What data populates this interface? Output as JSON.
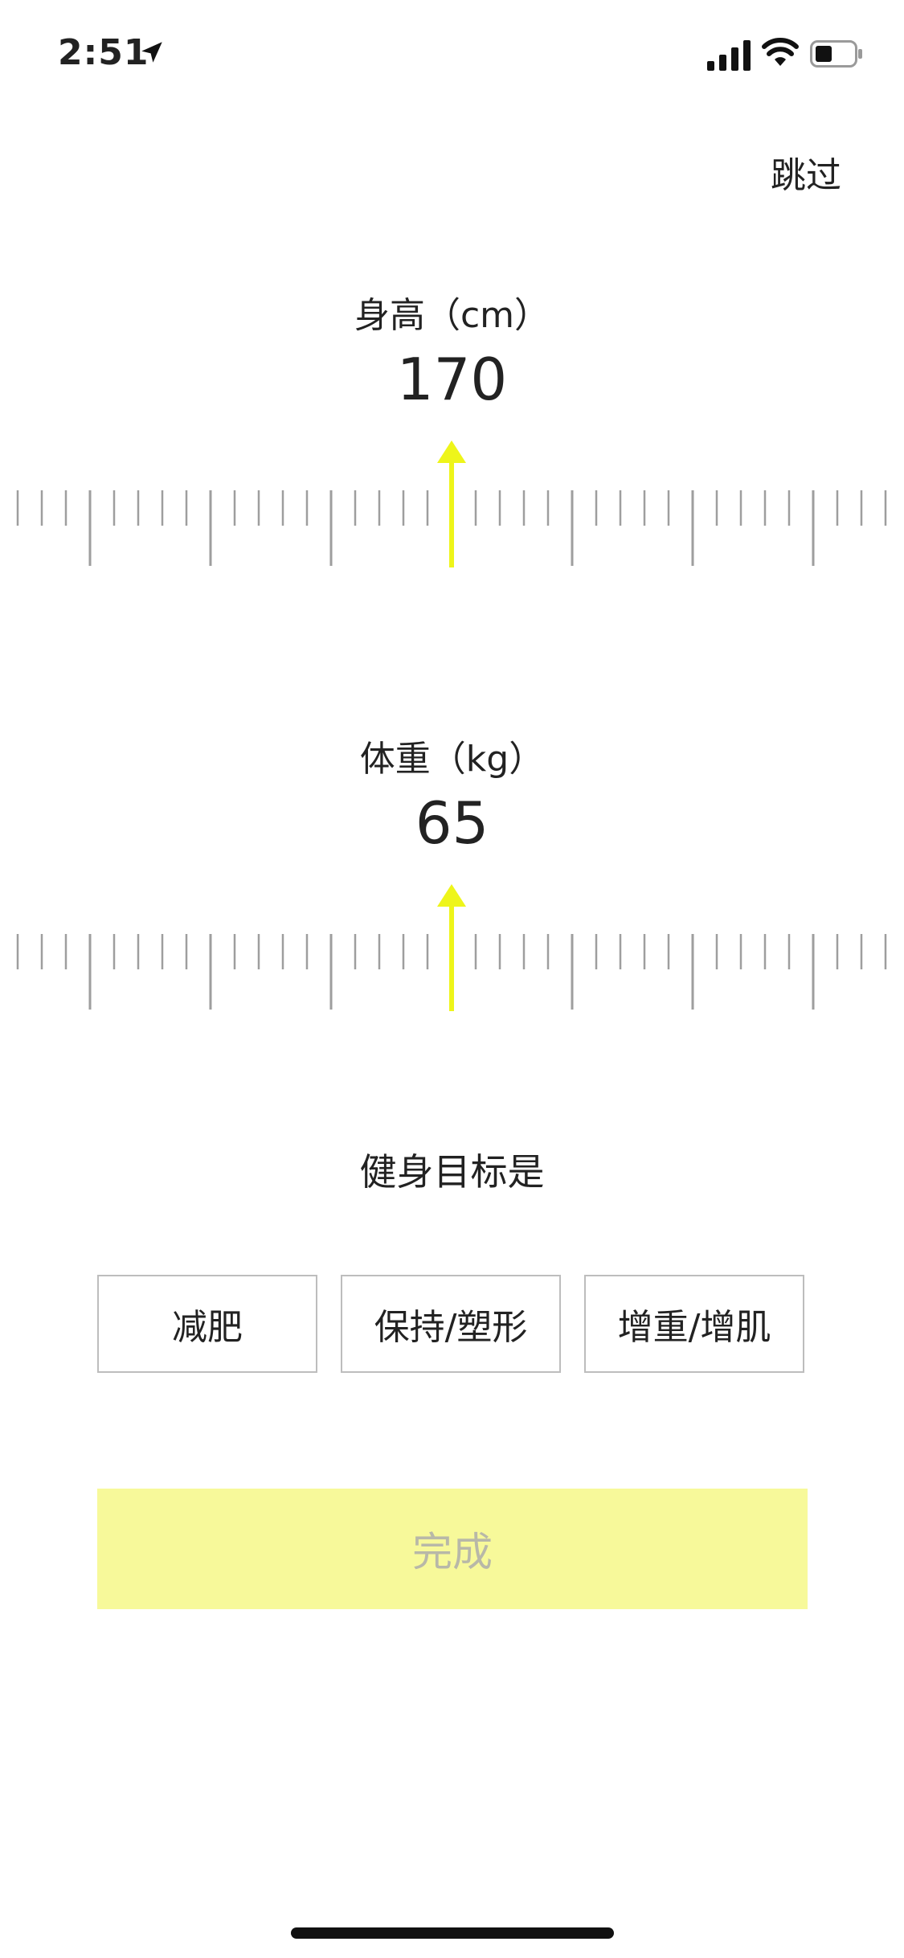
{
  "status_bar": {
    "time": "2:51"
  },
  "nav": {
    "skip_label": "跳过"
  },
  "height_section": {
    "label": "身高（cm）",
    "value": "170"
  },
  "weight_section": {
    "label": "体重（kg）",
    "value": "65"
  },
  "goal_section": {
    "title": "健身目标是",
    "options": [
      "减肥",
      "保持/塑形",
      "增重/增肌"
    ]
  },
  "actions": {
    "done_label": "完成"
  },
  "colors": {
    "accent": "#eef51a",
    "done_bg": "#f7f99a",
    "tick": "#9e9e9e"
  }
}
